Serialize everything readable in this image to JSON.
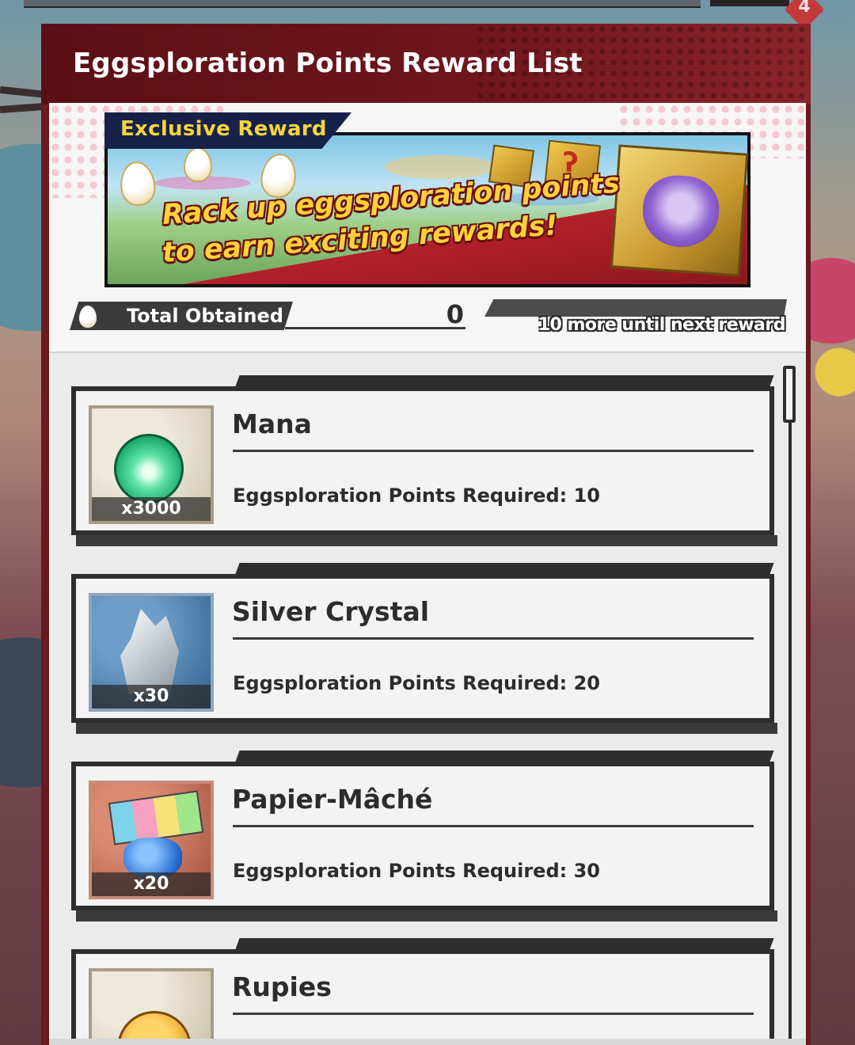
{
  "window": {
    "badge_count": "4",
    "title": "Eggsploration Points Reward List"
  },
  "banner": {
    "tag": "Exclusive Reward",
    "line1": "Rack up eggsploration points",
    "line2": "to earn exciting rewards!"
  },
  "progress": {
    "label": "Total Obtained",
    "total": "0",
    "fraction": 0,
    "next_reward_text": "10 more until next reward"
  },
  "rewards": [
    {
      "name": "Mana",
      "quantity": "x3000",
      "requirement": "Eggsploration Points Required: 10",
      "icon": "mana-orb-icon"
    },
    {
      "name": "Silver Crystal",
      "quantity": "x30",
      "requirement": "Eggsploration Points Required: 20",
      "icon": "silver-crystal-icon"
    },
    {
      "name": "Papier-Mâché",
      "quantity": "x20",
      "requirement": "Eggsploration Points Required: 30",
      "icon": "papier-mache-icon"
    },
    {
      "name": "Rupies",
      "quantity": "",
      "requirement": "",
      "icon": "rupies-coin-icon"
    }
  ],
  "colors": {
    "header_red": "#6e161c",
    "banner_text_gold": "#ffd23a",
    "tag_gold": "#f7d43a",
    "card_border": "#2e2e2e"
  }
}
